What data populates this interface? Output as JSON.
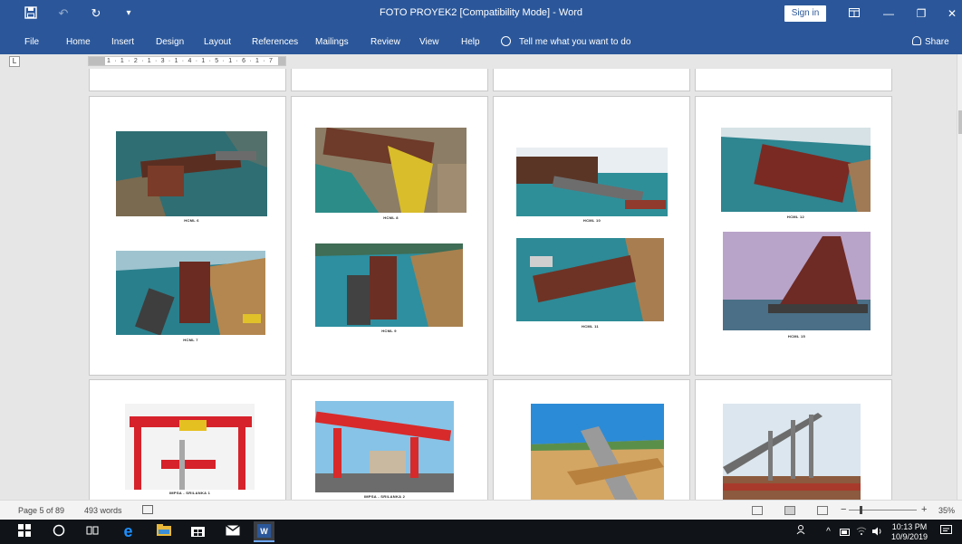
{
  "window": {
    "title": "FOTO PROYEK2 [Compatibility Mode]  -  Word",
    "sign_in": "Sign in"
  },
  "ribbon": {
    "tabs": [
      "File",
      "Home",
      "Insert",
      "Design",
      "Layout",
      "References",
      "Mailings",
      "Review",
      "View",
      "Help"
    ],
    "tell_me": "Tell me what you want to do",
    "share": "Share"
  },
  "ruler": {
    "numbers": "1 · 1 · 2 · 1 · 3 · 1 · 4 · 1 · 5 · 1 · 6 · 1 · 7"
  },
  "captions": {
    "p1": [
      "HCML 6",
      "HCML 7"
    ],
    "p2": [
      "HCML 8",
      "HCML 9"
    ],
    "p3": [
      "HCML 10",
      "HCML 11"
    ],
    "p4": [
      "HCML 12",
      "HCML 15"
    ],
    "p5": [
      "IMPSA - SRILANKA 1"
    ],
    "p6": [
      "IMPSA - SRILANKA 2"
    ]
  },
  "status": {
    "page": "Page 5 of 89",
    "words": "493 words",
    "zoom": "35%",
    "zoom_minus": "−",
    "zoom_plus": "+"
  },
  "taskbar": {
    "time": "10:13 PM",
    "date": "10/9/2019"
  },
  "colors": {
    "word_blue": "#2b579a",
    "taskbar": "#101418"
  }
}
